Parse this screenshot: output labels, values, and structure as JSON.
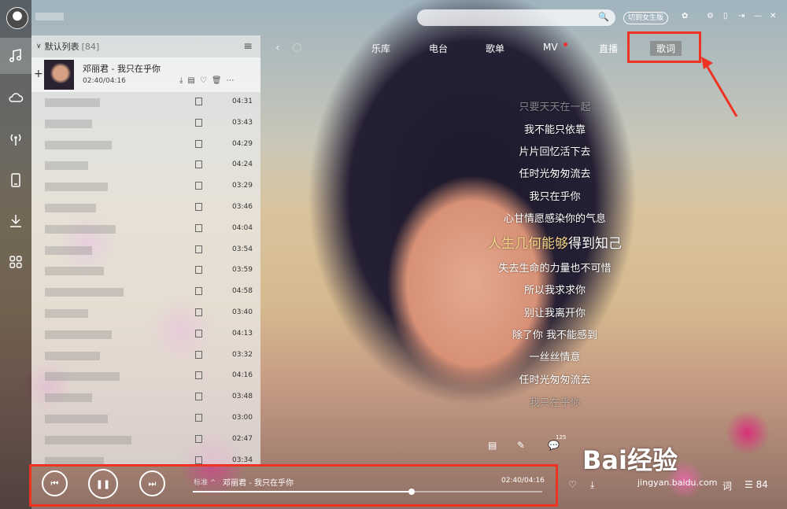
{
  "sidebar": {
    "items": [
      "music-icon",
      "cloud-icon",
      "radio-icon",
      "device-icon",
      "download-icon",
      "apps-icon"
    ]
  },
  "playlist": {
    "title": "默认列表",
    "count": "[84]",
    "now_playing": {
      "title": "邓丽君 - 我只在乎你",
      "time": "02:40/04:16"
    },
    "durations": [
      "04:31",
      "03:43",
      "04:29",
      "04:24",
      "03:29",
      "03:46",
      "04:04",
      "03:54",
      "03:59",
      "04:58",
      "03:40",
      "04:13",
      "03:32",
      "04:16",
      "03:48",
      "03:00",
      "02:47",
      "03:34"
    ]
  },
  "topbar": {
    "switch_label": "切到女生版",
    "tabs": [
      "乐库",
      "电台",
      "歌单",
      "MV",
      "直播"
    ],
    "active_tab": "歌词"
  },
  "lyrics": {
    "lines_before": [
      "只要天天在一起",
      "我不能只依靠",
      "片片回忆活下去",
      "任时光匆匆流去",
      "我只在乎你",
      "心甘情愿感染你的气息"
    ],
    "current_done": "人生几何能够",
    "current_rest": "得到知己",
    "lines_after": [
      "失去生命的力量也不可惜",
      "所以我求求你",
      "别让我离开你",
      "除了你 我不能感到",
      "一丝丝情意",
      "任时光匆匆流去",
      "我只在乎你"
    ]
  },
  "lyric_tools": {
    "comment_count": "125"
  },
  "player": {
    "quality": "标准",
    "title": "邓丽君 - 我只在乎你",
    "time": "02:40/04:16",
    "progress": 0.625,
    "lyric_btn": "词",
    "list_count": "84"
  },
  "watermark": {
    "brand": "Bai经验",
    "url": "jingyan.baidu.com"
  }
}
